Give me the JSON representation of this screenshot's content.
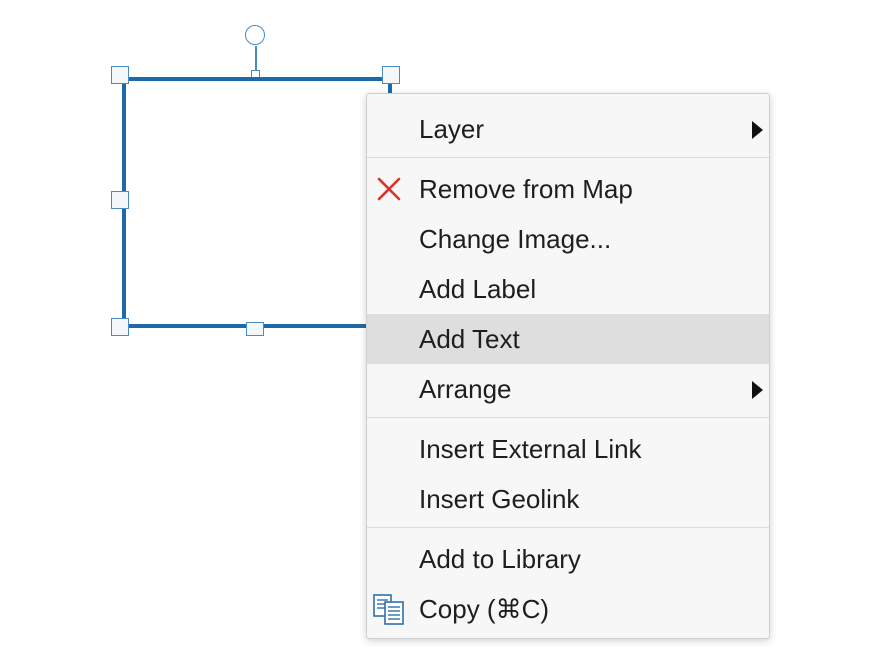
{
  "canvas": {
    "selected_shape": "rectangle-image"
  },
  "context_menu": {
    "items": [
      {
        "id": "layer",
        "label": "Layer",
        "submenu": true
      },
      {
        "id": "remove-from-map",
        "label": "Remove from Map",
        "icon": "red-x-icon"
      },
      {
        "id": "change-image",
        "label": "Change Image..."
      },
      {
        "id": "add-label",
        "label": "Add Label"
      },
      {
        "id": "add-text",
        "label": "Add Text",
        "highlighted": true
      },
      {
        "id": "arrange",
        "label": "Arrange",
        "submenu": true
      },
      {
        "id": "insert-external-link",
        "label": "Insert External Link"
      },
      {
        "id": "insert-geolink",
        "label": "Insert Geolink"
      },
      {
        "id": "add-to-library",
        "label": "Add to Library"
      },
      {
        "id": "copy",
        "label": "Copy (⌘C)",
        "icon": "copy-icon"
      }
    ]
  },
  "colors": {
    "selection_border": "#1e6aa8",
    "handle_border": "#4a8cc4",
    "menu_background": "#f7f7f7",
    "menu_hover": "#dedede",
    "remove_icon": "#d9342b",
    "copy_icon": "#2f6fad"
  }
}
